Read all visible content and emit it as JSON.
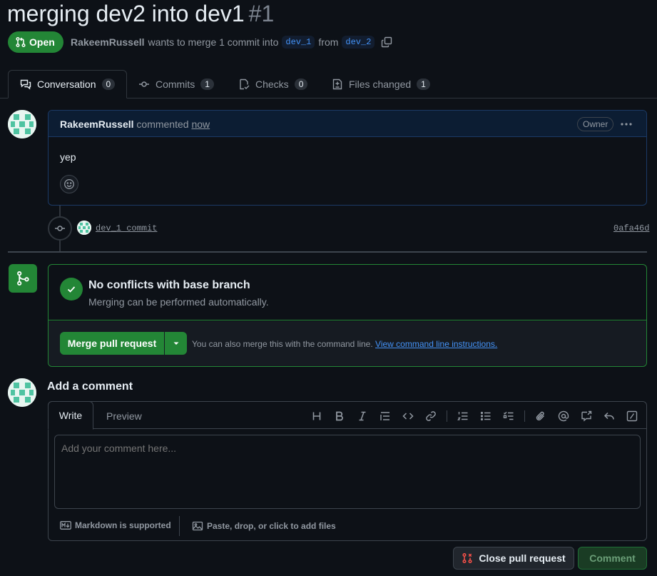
{
  "pr": {
    "title": "merging dev2 into dev1",
    "number": "#1",
    "state": "Open",
    "author": "RakeemRussell",
    "summary_middle": "wants to merge 1 commit into",
    "base_branch": "dev_1",
    "from_word": "from",
    "head_branch": "dev_2"
  },
  "tabs": [
    {
      "label": "Conversation",
      "count": "0",
      "icon": "comment-discussion-icon"
    },
    {
      "label": "Commits",
      "count": "1",
      "icon": "git-commit-icon"
    },
    {
      "label": "Checks",
      "count": "0",
      "icon": "checklist-icon"
    },
    {
      "label": "Files changed",
      "count": "1",
      "icon": "file-diff-icon"
    }
  ],
  "comment": {
    "author": "RakeemRussell",
    "action": "commented",
    "time": "now",
    "role_badge": "Owner",
    "body": "yep"
  },
  "commit": {
    "message": "dev_1 commit",
    "sha": "0afa46d"
  },
  "merge": {
    "status_title": "No conflicts with base branch",
    "status_sub": "Merging can be performed automatically.",
    "button_label": "Merge pull request",
    "note": "You can also merge this with the command line.",
    "note_link": "View command line instructions."
  },
  "add_comment": {
    "title": "Add a comment",
    "tab_write": "Write",
    "tab_preview": "Preview",
    "placeholder": "Add your comment here...",
    "markdown_note": "Markdown is supported",
    "attach_note": "Paste, drop, or click to add files",
    "toolbar": [
      "heading-icon",
      "bold-icon",
      "italic-icon",
      "quote-icon",
      "code-icon",
      "link-icon",
      "ordered-list-icon",
      "unordered-list-icon",
      "task-list-icon",
      "paperclip-icon",
      "mention-icon",
      "cross-reference-icon",
      "reply-icon",
      "slash-command-icon"
    ]
  },
  "actions": {
    "close_label": "Close pull request",
    "comment_label": "Comment"
  },
  "colors": {
    "background": "#0d1117",
    "success": "#238636",
    "link": "#4493f8",
    "danger": "#f85149"
  }
}
